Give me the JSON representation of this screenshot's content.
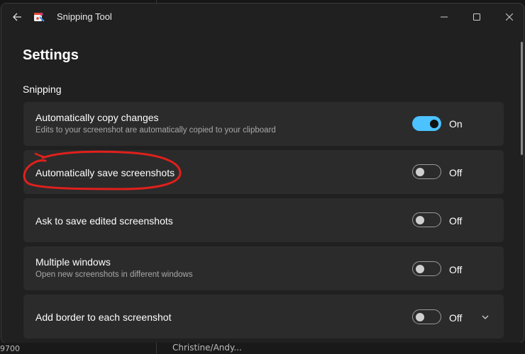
{
  "window": {
    "title": "Snipping Tool"
  },
  "backdrop": {
    "left_text": "9700",
    "mid_text": "Christine/Andy..."
  },
  "page": {
    "title": "Settings",
    "section": "Snipping"
  },
  "settings": [
    {
      "title": "Automatically copy changes",
      "description": "Edits to your screenshot are automatically copied to your clipboard",
      "state": "On",
      "enabled": true
    },
    {
      "title": "Automatically save screenshots",
      "description": "",
      "state": "Off",
      "enabled": false
    },
    {
      "title": "Ask to save edited screenshots",
      "description": "",
      "state": "Off",
      "enabled": false
    },
    {
      "title": "Multiple windows",
      "description": "Open new screenshots in different windows",
      "state": "Off",
      "enabled": false
    },
    {
      "title": "Add border to each screenshot",
      "description": "",
      "state": "Off",
      "enabled": false,
      "expandable": true
    }
  ],
  "colors": {
    "accent": "#4cc2ff",
    "annotation": "#e0201c"
  },
  "icons": {
    "back": "arrow-left-icon",
    "app": "snipping-tool-icon",
    "minimize": "minimize-icon",
    "maximize": "maximize-icon",
    "close": "close-icon",
    "expand": "chevron-down-icon"
  }
}
